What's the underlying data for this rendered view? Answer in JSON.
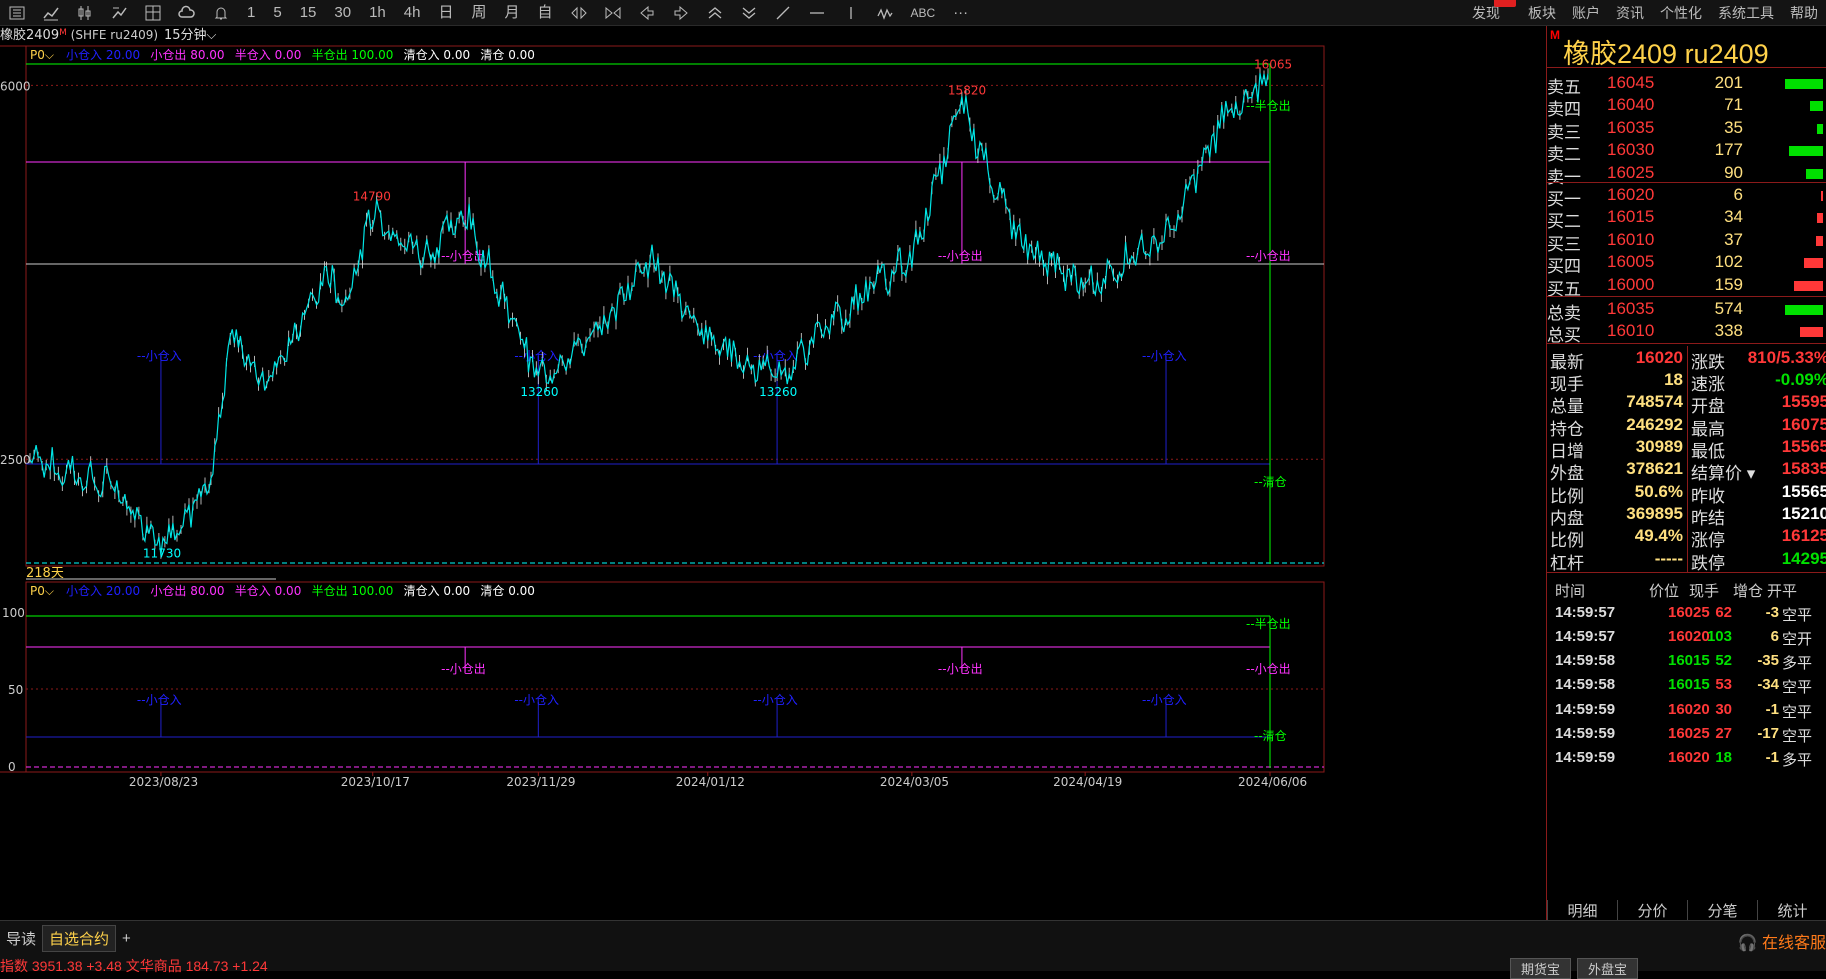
{
  "toolbar": {
    "left_items": [
      {
        "name": "list-icon",
        "label": ""
      },
      {
        "name": "line-chart-icon",
        "label": ""
      },
      {
        "name": "candlestick-icon",
        "label": ""
      },
      {
        "name": "split-icon",
        "label": ""
      },
      {
        "name": "grid-icon",
        "label": ""
      },
      {
        "name": "cloud-icon",
        "label": ""
      },
      {
        "name": "bell-icon",
        "label": ""
      },
      {
        "name": "period-1",
        "label": "1"
      },
      {
        "name": "period-5",
        "label": "5"
      },
      {
        "name": "period-15",
        "label": "15"
      },
      {
        "name": "period-30",
        "label": "30"
      },
      {
        "name": "period-1h",
        "label": "1h"
      },
      {
        "name": "period-4h",
        "label": "4h"
      },
      {
        "name": "period-day",
        "label": "日"
      },
      {
        "name": "period-week",
        "label": "周"
      },
      {
        "name": "period-month",
        "label": "月"
      },
      {
        "name": "period-custom",
        "label": "自"
      },
      {
        "name": "expand-icon",
        "label": ""
      },
      {
        "name": "collapse-icon",
        "label": ""
      },
      {
        "name": "arrow-left-icon",
        "label": ""
      },
      {
        "name": "arrow-right-icon",
        "label": ""
      },
      {
        "name": "chevron-up-icon",
        "label": ""
      },
      {
        "name": "chevron-down-icon",
        "label": ""
      },
      {
        "name": "draw-line-icon",
        "label": ""
      },
      {
        "name": "horizontal-line-icon",
        "label": ""
      },
      {
        "name": "vertical-line-icon",
        "label": ""
      },
      {
        "name": "wave-icon",
        "label": ""
      },
      {
        "name": "abc-text",
        "label": "ABC"
      },
      {
        "name": "more-icon",
        "label": "···"
      }
    ],
    "right_items": [
      "发现",
      "板块",
      "账户",
      "资讯",
      "个性化",
      "系统工具",
      "帮助"
    ]
  },
  "chart": {
    "symbol_title": "橡胶2409",
    "symbol_marker": "M",
    "symbol_code": "(SHFE ru2409)",
    "period": "15分钟",
    "legend": [
      {
        "label": "P0",
        "color": "#ffd24a"
      },
      {
        "label": "小仓入 20.00",
        "color": "#2020ff"
      },
      {
        "label": "小仓出 80.00",
        "color": "#ff33ff"
      },
      {
        "label": "半仓入 0.00",
        "color": "#ff33ff"
      },
      {
        "label": "半仓出 100.00",
        "color": "#00ff00"
      },
      {
        "label": "清仓入 0.00",
        "color": "#ffffff"
      },
      {
        "label": "清仓 0.00",
        "color": "#ffffff"
      }
    ],
    "y_ticks_main": [
      {
        "v": 16000,
        "label": "6000"
      },
      {
        "v": 12500,
        "label": "2500"
      }
    ],
    "y_ticks_sub": [
      {
        "v": 100,
        "label": "100"
      },
      {
        "v": 50,
        "label": "50"
      },
      {
        "v": 0,
        "label": "0"
      }
    ],
    "x_ticks": [
      "2023/08/23",
      "2023/10/17",
      "2023/11/29",
      "2024/01/12",
      "2024/03/05",
      "2024/04/19",
      "2024/06/06"
    ],
    "extreme_labels": [
      {
        "text": "16065",
        "color": "#ff3838"
      },
      {
        "text": "15820",
        "color": "#ff3838"
      },
      {
        "text": "14790",
        "color": "#ff3838"
      },
      {
        "text": "13260",
        "color": "#00ffff"
      },
      {
        "text": "13260",
        "color": "#00ffff"
      },
      {
        "text": "11730",
        "color": "#00ffff"
      }
    ],
    "signal_labels": {
      "half_out": "半仓出",
      "small_out": "小仓出",
      "small_in": "小仓入",
      "clear": "清仓"
    },
    "days_label": "218天"
  },
  "chart_data": {
    "type": "candlestick",
    "title": "橡胶2409",
    "series": [
      {
        "name": "小仓入",
        "values": [
          20
        ]
      },
      {
        "name": "小仓出",
        "values": [
          80
        ]
      },
      {
        "name": "半仓出",
        "values": [
          100
        ]
      }
    ],
    "price_points": [
      {
        "x": "2023/07/20",
        "y": 12500
      },
      {
        "x": "2023/08/10",
        "y": 12250
      },
      {
        "x": "2023/08/23",
        "y": 11730
      },
      {
        "x": "2023/09/05",
        "y": 12200
      },
      {
        "x": "2023/09/10",
        "y": 13700
      },
      {
        "x": "2023/09/20",
        "y": 13200
      },
      {
        "x": "2023/10/05",
        "y": 14200
      },
      {
        "x": "2023/10/10",
        "y": 14000
      },
      {
        "x": "2023/10/17",
        "y": 14790
      },
      {
        "x": "2023/10/30",
        "y": 14400
      },
      {
        "x": "2023/11/10",
        "y": 14790
      },
      {
        "x": "2023/11/29",
        "y": 13260
      },
      {
        "x": "2023/12/15",
        "y": 13700
      },
      {
        "x": "2023/12/28",
        "y": 14400
      },
      {
        "x": "2024/01/12",
        "y": 13600
      },
      {
        "x": "2024/01/30",
        "y": 13260
      },
      {
        "x": "2024/02/20",
        "y": 14000
      },
      {
        "x": "2024/03/05",
        "y": 14400
      },
      {
        "x": "2024/03/18",
        "y": 15820
      },
      {
        "x": "2024/04/01",
        "y": 14600
      },
      {
        "x": "2024/04/19",
        "y": 14100
      },
      {
        "x": "2024/05/10",
        "y": 14600
      },
      {
        "x": "2024/05/25",
        "y": 15700
      },
      {
        "x": "2024/06/06",
        "y": 16065
      }
    ],
    "ylim_main": [
      11500,
      16200
    ],
    "ylim_sub": [
      0,
      100
    ]
  },
  "quote": {
    "title": "橡胶2409  ru2409",
    "marker": "M",
    "asks": [
      {
        "label": "卖五",
        "price": "16045",
        "vol": "201",
        "bar": 0.9
      },
      {
        "label": "卖四",
        "price": "16040",
        "vol": "71",
        "bar": 0.3
      },
      {
        "label": "卖三",
        "price": "16035",
        "vol": "35",
        "bar": 0.15
      },
      {
        "label": "卖二",
        "price": "16030",
        "vol": "177",
        "bar": 0.8
      },
      {
        "label": "卖一",
        "price": "16025",
        "vol": "90",
        "bar": 0.4
      }
    ],
    "bids": [
      {
        "label": "买一",
        "price": "16020",
        "vol": "6",
        "bar": 0.05
      },
      {
        "label": "买二",
        "price": "16015",
        "vol": "34",
        "bar": 0.15
      },
      {
        "label": "买三",
        "price": "16010",
        "vol": "37",
        "bar": 0.17
      },
      {
        "label": "买四",
        "price": "16005",
        "vol": "102",
        "bar": 0.45
      },
      {
        "label": "买五",
        "price": "16000",
        "vol": "159",
        "bar": 0.7
      }
    ],
    "totals": [
      {
        "label": "总卖",
        "price": "16035",
        "vol": "574",
        "color": "#00e000",
        "bar": 0.9
      },
      {
        "label": "总买",
        "price": "16010",
        "vol": "338",
        "color": "#ff3838",
        "bar": 0.55
      }
    ],
    "stats_left": [
      {
        "label": "最新",
        "value": "16020",
        "cls": "r"
      },
      {
        "label": "现手",
        "value": "18",
        "cls": ""
      },
      {
        "label": "总量",
        "value": "748574",
        "cls": ""
      },
      {
        "label": "持仓",
        "value": "246292",
        "cls": ""
      },
      {
        "label": "日增",
        "value": "30989",
        "cls": ""
      },
      {
        "label": "外盘",
        "value": "378621",
        "cls": ""
      },
      {
        "label": "比例",
        "value": "50.6%",
        "cls": ""
      },
      {
        "label": "内盘",
        "value": "369895",
        "cls": ""
      },
      {
        "label": "比例",
        "value": "49.4%",
        "cls": ""
      },
      {
        "label": "杠杆",
        "value": "-----",
        "cls": ""
      }
    ],
    "stats_right": [
      {
        "label": "涨跌",
        "value": "810/5.33%",
        "cls": "r"
      },
      {
        "label": "速涨",
        "value": "-0.09%",
        "cls": "g"
      },
      {
        "label": "开盘",
        "value": "15595",
        "cls": "r"
      },
      {
        "label": "最高",
        "value": "16075",
        "cls": "r"
      },
      {
        "label": "最低",
        "value": "15565",
        "cls": "r"
      },
      {
        "label": "结算价",
        "value": "15835",
        "cls": "r"
      },
      {
        "label": "昨收",
        "value": "15565",
        "cls": "w"
      },
      {
        "label": "昨结",
        "value": "15210",
        "cls": "w"
      },
      {
        "label": "涨停",
        "value": "16125",
        "cls": "r"
      },
      {
        "label": "跌停",
        "value": "14295",
        "cls": "g"
      }
    ],
    "tick_headers": [
      "时间",
      "价位",
      "现手",
      "增仓",
      "开平"
    ],
    "ticks": [
      {
        "time": "14:59:57",
        "price": "16025",
        "vol": "62",
        "chg": "-3",
        "type": "空平",
        "pc": "r",
        "vc": "rr",
        "cc": "y"
      },
      {
        "time": "14:59:57",
        "price": "16020",
        "vol": "103",
        "chg": "6",
        "type": "空开",
        "pc": "r",
        "vc": "gg",
        "cc": "y"
      },
      {
        "time": "14:59:58",
        "price": "16015",
        "vol": "52",
        "chg": "-35",
        "type": "多平",
        "pc": "g",
        "vc": "gg",
        "cc": "y"
      },
      {
        "time": "14:59:58",
        "price": "16015",
        "vol": "53",
        "chg": "-34",
        "type": "空平",
        "pc": "g",
        "vc": "rr",
        "cc": "y"
      },
      {
        "time": "14:59:59",
        "price": "16020",
        "vol": "30",
        "chg": "-1",
        "type": "空平",
        "pc": "r",
        "vc": "rr",
        "cc": "y"
      },
      {
        "time": "14:59:59",
        "price": "16025",
        "vol": "27",
        "chg": "-17",
        "type": "空平",
        "pc": "r",
        "vc": "rr",
        "cc": "y"
      },
      {
        "time": "14:59:59",
        "price": "16020",
        "vol": "18",
        "chg": "-1",
        "type": "多平",
        "pc": "r",
        "vc": "gg",
        "cc": "y"
      }
    ],
    "tabs": [
      "明细",
      "分价",
      "分笔",
      "统计"
    ]
  },
  "bottom": {
    "tabs": [
      "导读",
      "自选合约",
      "+"
    ],
    "service": "在线客服",
    "index_text": "指数 3951.38 +3.48  文华商品 184.73 +1.24",
    "buttons": [
      "期货宝",
      "外盘宝"
    ]
  }
}
